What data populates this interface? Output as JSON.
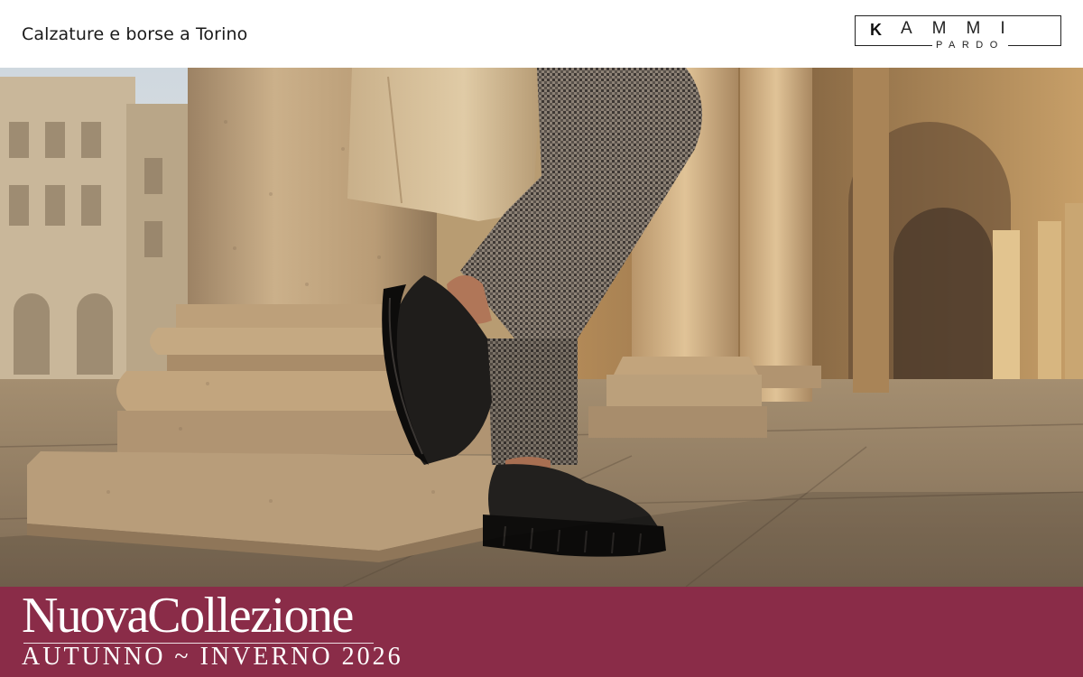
{
  "header": {
    "tagline": "Calzature e borse a Torino",
    "logo": {
      "brand": "KAMMI",
      "initial": "K",
      "rest": "AMMI",
      "sub": "PARDO"
    }
  },
  "hero": {
    "image_description": "Close-up of legs in houndstooth trousers and black suede lace-up shoes with chunky soles, leaning on a stone column under the arcades of Turin",
    "colors": {
      "stone": "#c8ae86",
      "trench": "#d6bf9a",
      "shoe": "#1f1d1b",
      "houndstooth": "#6e655c"
    }
  },
  "banner": {
    "headline_part1": "Nuova",
    "headline_part2": "Collezione",
    "season": "AUTUNNO ~ INVERNO 2026",
    "color": "#8a2c48"
  }
}
